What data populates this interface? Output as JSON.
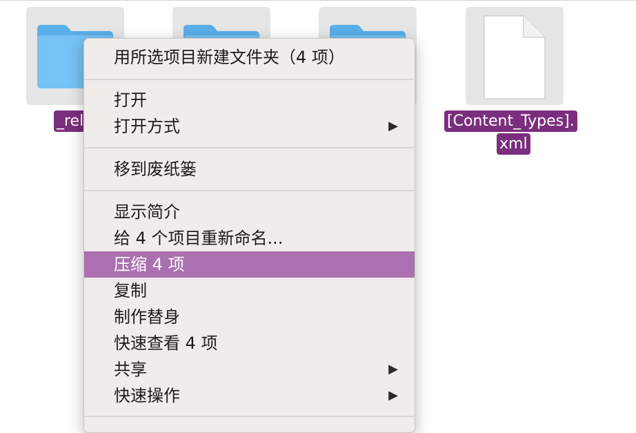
{
  "desktop": {
    "files": [
      {
        "name": "_rel",
        "kind": "folder-icon"
      },
      {
        "name": "",
        "kind": "folder-icon"
      },
      {
        "name": "",
        "kind": "folder-icon"
      },
      {
        "name_line1": "[Content_Types].",
        "name_line2": "xml",
        "kind": "document-icon"
      }
    ],
    "folder_color": "#6cb8ef",
    "selection_color": "#7b2e7d"
  },
  "context_menu": {
    "new_folder": "用所选项目新建文件夹（4 项）",
    "open": "打开",
    "open_with": "打开方式",
    "move_to_trash": "移到废纸篓",
    "get_info": "显示简介",
    "rename": "给 4 个项目重新命名...",
    "compress": "压缩 4 项",
    "duplicate": "复制",
    "make_alias": "制作替身",
    "quick_look": "快速查看 4 项",
    "share": "共享",
    "quick_actions": "快速操作",
    "submenu_arrow": "▶",
    "highlight_color": "#ab70b0"
  }
}
